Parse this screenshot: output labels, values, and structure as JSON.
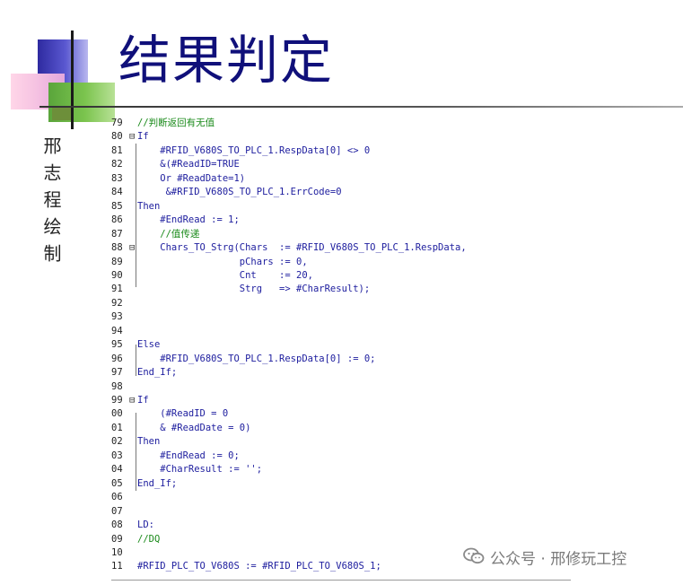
{
  "slide": {
    "title": "结果判定",
    "author": "邢志程绘制"
  },
  "code_lines": [
    {
      "num": "79",
      "fold": "",
      "parts": [
        {
          "cls": "cm",
          "t": "//判断返回有无值"
        }
      ]
    },
    {
      "num": "80",
      "fold": "⊟",
      "parts": [
        {
          "cls": "kw",
          "t": "If"
        }
      ]
    },
    {
      "num": "81",
      "fold": "",
      "parts": [
        {
          "cls": "tx",
          "t": "    #RFID_V680S_TO_PLC_1.RespData[0] <> 0"
        }
      ]
    },
    {
      "num": "82",
      "fold": "",
      "parts": [
        {
          "cls": "tx",
          "t": "    &(#ReadID=TRUE"
        }
      ]
    },
    {
      "num": "83",
      "fold": "",
      "parts": [
        {
          "cls": "tx",
          "t": "    Or #ReadDate=1)"
        }
      ]
    },
    {
      "num": "84",
      "fold": "",
      "parts": [
        {
          "cls": "tx",
          "t": "     &#RFID_V680S_TO_PLC_1.ErrCode=0"
        }
      ]
    },
    {
      "num": "85",
      "fold": "",
      "parts": [
        {
          "cls": "kw",
          "t": "Then"
        }
      ]
    },
    {
      "num": "86",
      "fold": "",
      "parts": [
        {
          "cls": "tx",
          "t": "    #EndRead := 1;"
        }
      ]
    },
    {
      "num": "87",
      "fold": "",
      "parts": [
        {
          "cls": "cm",
          "t": "    //值传递"
        }
      ]
    },
    {
      "num": "88",
      "fold": "⊟",
      "parts": [
        {
          "cls": "tx",
          "t": "    Chars_TO_Strg(Chars  := #RFID_V680S_TO_PLC_1.RespData,"
        }
      ]
    },
    {
      "num": "89",
      "fold": "",
      "parts": [
        {
          "cls": "tx",
          "t": "                  pChars := 0,"
        }
      ]
    },
    {
      "num": "90",
      "fold": "",
      "parts": [
        {
          "cls": "tx",
          "t": "                  Cnt    := 20,"
        }
      ]
    },
    {
      "num": "91",
      "fold": "",
      "parts": [
        {
          "cls": "tx",
          "t": "                  Strg   => #CharResult);"
        }
      ]
    },
    {
      "num": "92",
      "fold": "",
      "parts": []
    },
    {
      "num": "93",
      "fold": "",
      "parts": []
    },
    {
      "num": "94",
      "fold": "",
      "parts": []
    },
    {
      "num": "95",
      "fold": "",
      "parts": [
        {
          "cls": "kw",
          "t": "Else"
        }
      ]
    },
    {
      "num": "96",
      "fold": "",
      "parts": [
        {
          "cls": "tx",
          "t": "    #RFID_V680S_TO_PLC_1.RespData[0] := 0;"
        }
      ]
    },
    {
      "num": "97",
      "fold": "",
      "parts": [
        {
          "cls": "kw",
          "t": "End_If;"
        }
      ]
    },
    {
      "num": "98",
      "fold": "",
      "parts": []
    },
    {
      "num": "99",
      "fold": "⊟",
      "parts": [
        {
          "cls": "kw",
          "t": "If"
        }
      ]
    },
    {
      "num": "00",
      "fold": "",
      "parts": [
        {
          "cls": "tx",
          "t": "    (#ReadID = 0"
        }
      ]
    },
    {
      "num": "01",
      "fold": "",
      "parts": [
        {
          "cls": "tx",
          "t": "    & #ReadDate = 0)"
        }
      ]
    },
    {
      "num": "02",
      "fold": "",
      "parts": [
        {
          "cls": "kw",
          "t": "Then"
        }
      ]
    },
    {
      "num": "03",
      "fold": "",
      "parts": [
        {
          "cls": "tx",
          "t": "    #EndRead := 0;"
        }
      ]
    },
    {
      "num": "04",
      "fold": "",
      "parts": [
        {
          "cls": "tx",
          "t": "    #CharResult := '';"
        }
      ]
    },
    {
      "num": "05",
      "fold": "",
      "parts": [
        {
          "cls": "kw",
          "t": "End_If;"
        }
      ]
    },
    {
      "num": "06",
      "fold": "",
      "parts": []
    },
    {
      "num": "07",
      "fold": "",
      "parts": []
    },
    {
      "num": "08",
      "fold": "",
      "parts": [
        {
          "cls": "kw",
          "t": "LD:"
        }
      ]
    },
    {
      "num": "09",
      "fold": "",
      "parts": [
        {
          "cls": "cm",
          "t": "//DQ"
        }
      ]
    },
    {
      "num": "10",
      "fold": "",
      "parts": []
    },
    {
      "num": "11",
      "fold": "",
      "parts": [
        {
          "cls": "tx",
          "t": "#RFID_PLC_TO_V680S := #RFID_PLC_TO_V680S_1;"
        }
      ]
    }
  ],
  "watermark": {
    "text": "公众号 · 邢修玩工控",
    "icon": "wechat-icon"
  },
  "colors": {
    "title": "#10107a",
    "keyword": "#1d1d9e",
    "comment": "#1a8a1a"
  }
}
